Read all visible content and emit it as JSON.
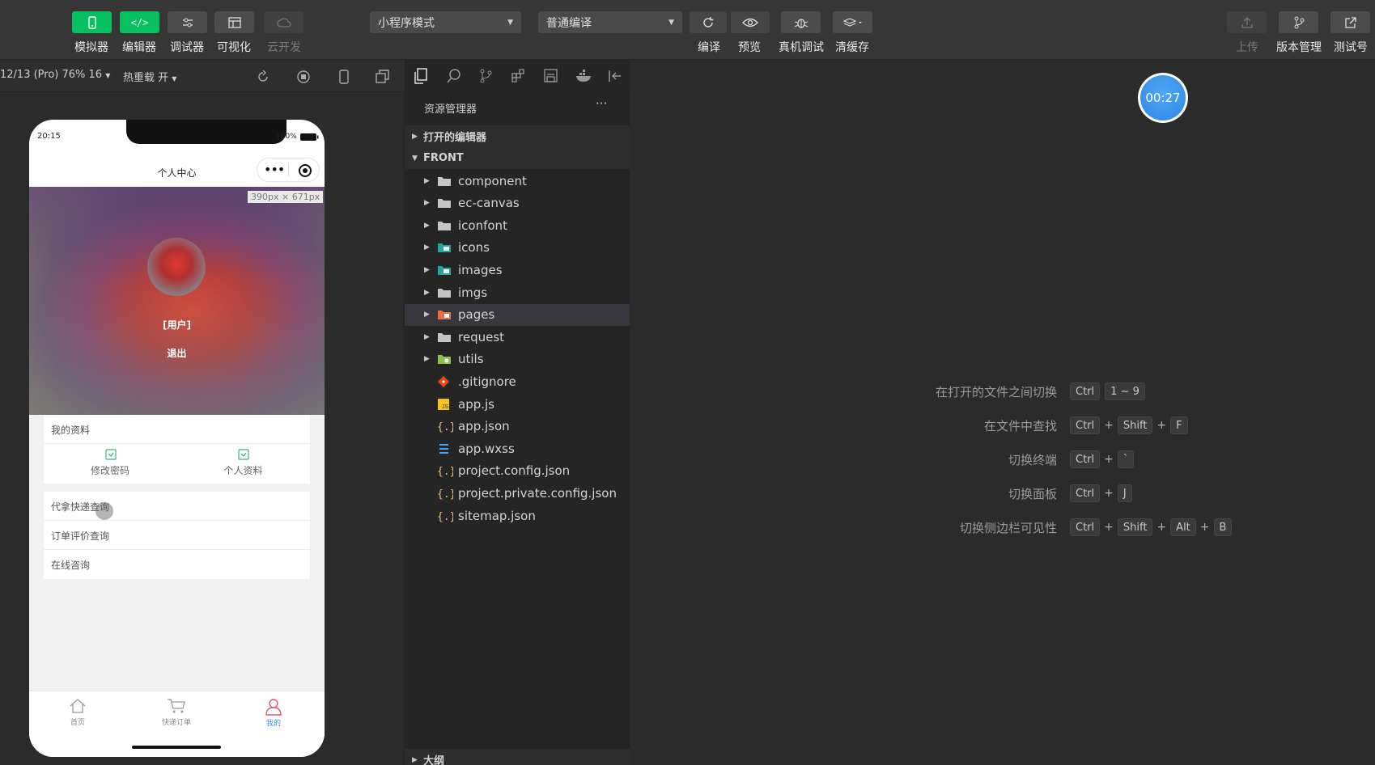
{
  "toolbar": {
    "left_buttons": [
      {
        "label": "模拟器",
        "icon": "phone-icon",
        "style": "green"
      },
      {
        "label": "编辑器",
        "icon": "code-icon",
        "style": "green"
      },
      {
        "label": "调试器",
        "icon": "debug-sliders-icon",
        "style": "gray"
      },
      {
        "label": "可视化",
        "icon": "layout-icon",
        "style": "gray"
      },
      {
        "label": "云开发",
        "icon": "cloud-icon",
        "style": "dim"
      }
    ],
    "mode_select": "小程序模式",
    "compile_select": "普通编译",
    "actions": [
      {
        "label": "编译",
        "icon": "refresh-icon"
      },
      {
        "label": "预览",
        "icon": "eye-icon"
      },
      {
        "label": "真机调试",
        "icon": "bug-icon"
      },
      {
        "label": "清缓存",
        "icon": "layers-icon"
      }
    ],
    "right_buttons": [
      {
        "label": "上传",
        "icon": "upload-icon",
        "disabled": true
      },
      {
        "label": "版本管理",
        "icon": "branch-icon",
        "disabled": false
      },
      {
        "label": "测试号",
        "icon": "external-link-icon",
        "disabled": false
      }
    ]
  },
  "sim_bar": {
    "device": "12/13 (Pro) 76% 16",
    "hot_reload": "热重载 开"
  },
  "phone": {
    "time": "20:15",
    "battery": "100%",
    "nav_title": "个人中心",
    "size_tag": "390px × 671px",
    "username": "[用户]",
    "logout": "退出",
    "section_title": "我的资料",
    "grid_items": [
      "修改密码",
      "个人资料"
    ],
    "list_items": [
      "代拿快递查询",
      "订单评价查询",
      "在线咨询"
    ],
    "tabs": [
      {
        "label": "首页",
        "icon": "home-icon",
        "active": false
      },
      {
        "label": "快递订单",
        "icon": "cart-icon",
        "active": false
      },
      {
        "label": "我的",
        "icon": "user-icon",
        "active": true
      }
    ]
  },
  "explorer": {
    "title": "资源管理器",
    "more": "···",
    "open_editors": "打开的编辑器",
    "root": "FRONT",
    "items": [
      {
        "name": "component",
        "kind": "folder"
      },
      {
        "name": "ec-canvas",
        "kind": "folder"
      },
      {
        "name": "iconfont",
        "kind": "folder"
      },
      {
        "name": "icons",
        "kind": "folder-img"
      },
      {
        "name": "images",
        "kind": "folder-img"
      },
      {
        "name": "imgs",
        "kind": "folder"
      },
      {
        "name": "pages",
        "kind": "folder-pages"
      },
      {
        "name": "request",
        "kind": "folder"
      },
      {
        "name": "utils",
        "kind": "folder-utils"
      },
      {
        "name": ".gitignore",
        "kind": "git"
      },
      {
        "name": "app.js",
        "kind": "js"
      },
      {
        "name": "app.json",
        "kind": "json"
      },
      {
        "name": "app.wxss",
        "kind": "css"
      },
      {
        "name": "project.config.json",
        "kind": "json"
      },
      {
        "name": "project.private.config.json",
        "kind": "json"
      },
      {
        "name": "sitemap.json",
        "kind": "json"
      }
    ],
    "outline": "大纲"
  },
  "timer": "00:27",
  "shortcuts": [
    {
      "label": "在打开的文件之间切换",
      "keys": [
        "Ctrl",
        "1 ~ 9"
      ],
      "sep": [
        ""
      ]
    },
    {
      "label": "在文件中查找",
      "keys": [
        "Ctrl",
        "Shift",
        "F"
      ],
      "sep": [
        "+",
        "+"
      ]
    },
    {
      "label": "切换终端",
      "keys": [
        "Ctrl",
        "`"
      ],
      "sep": [
        "+"
      ]
    },
    {
      "label": "切换面板",
      "keys": [
        "Ctrl",
        "J"
      ],
      "sep": [
        "+"
      ]
    },
    {
      "label": "切换侧边栏可见性",
      "keys": [
        "Ctrl",
        "Shift",
        "Alt",
        "B"
      ],
      "sep": [
        "+",
        "+",
        "+"
      ]
    }
  ],
  "colors": {
    "green": "#07c160",
    "accent_blue": "#3a8ee6",
    "active_tab": "#e9546b",
    "grid_icon_green": "#3cb371"
  }
}
